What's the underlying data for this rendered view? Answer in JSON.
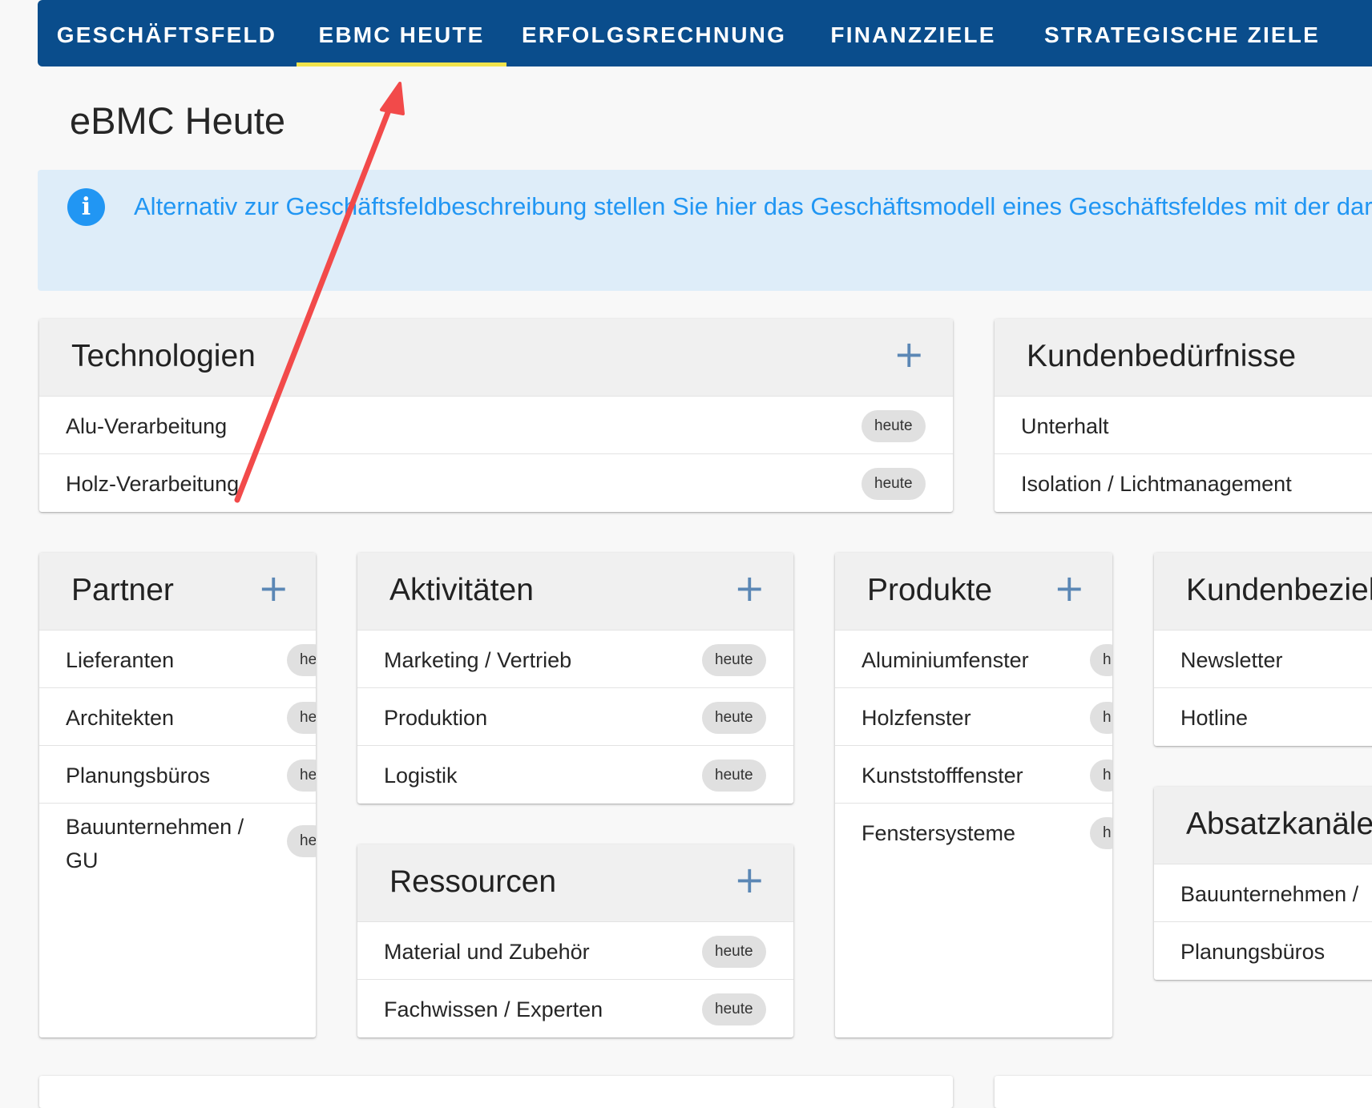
{
  "nav": {
    "tabs": [
      {
        "label": "GESCHÄFTSFELD"
      },
      {
        "label": "EBMC HEUTE"
      },
      {
        "label": "ERFOLGSRECHNUNG"
      },
      {
        "label": "FINANZZIELE"
      },
      {
        "label": "STRATEGISCHE ZIELE"
      }
    ],
    "active_tab": "EBMC HEUTE",
    "active_indicator_color": "#f1e34b"
  },
  "page": {
    "title": "eBMC Heute"
  },
  "info_box": {
    "icon": "info-icon",
    "text": "Alternativ zur Geschäftsfeldbeschreibung stellen Sie hier das Geschäftsmodell eines Geschäftsfeldes mit der dar."
  },
  "badge_label": "heute",
  "cards": {
    "technologien": {
      "title": "Technologien",
      "add_icon": "+",
      "items": [
        {
          "label": "Alu-Verarbeitung",
          "badge": "heute"
        },
        {
          "label": "Holz-Verarbeitung",
          "badge": "heute"
        }
      ]
    },
    "kundenbeduerfnisse": {
      "title": "Kundenbedürfnisse",
      "items": [
        {
          "label": "Unterhalt"
        },
        {
          "label": "Isolation / Lichtmanagement"
        }
      ]
    },
    "partner": {
      "title": "Partner",
      "add_icon": "+",
      "items": [
        {
          "label": "Lieferanten",
          "badge": "he"
        },
        {
          "label": "Architekten",
          "badge": "he"
        },
        {
          "label": "Planungsbüros",
          "badge": "he"
        },
        {
          "label": "Bauunternehmen / GU",
          "badge": "he"
        }
      ]
    },
    "aktivitaeten": {
      "title": "Aktivitäten",
      "add_icon": "+",
      "items": [
        {
          "label": "Marketing / Vertrieb",
          "badge": "heute"
        },
        {
          "label": "Produktion",
          "badge": "heute"
        },
        {
          "label": "Logistik",
          "badge": "heute"
        }
      ]
    },
    "ressourcen": {
      "title": "Ressourcen",
      "add_icon": "+",
      "items": [
        {
          "label": "Material und Zubehör",
          "badge": "heute"
        },
        {
          "label": "Fachwissen / Experten",
          "badge": "heute"
        }
      ]
    },
    "produkte": {
      "title": "Produkte",
      "add_icon": "+",
      "items": [
        {
          "label": "Aluminiumfenster",
          "badge": "h"
        },
        {
          "label": "Holzfenster",
          "badge": "h"
        },
        {
          "label": "Kunststofffenster",
          "badge": "h"
        },
        {
          "label": "Fenstersysteme",
          "badge": "h"
        }
      ]
    },
    "kundenbeziehungen": {
      "title": "Kundenbeziel",
      "items": [
        {
          "label": "Newsletter"
        },
        {
          "label": "Hotline"
        }
      ]
    },
    "absatzkanaele": {
      "title": "Absatzkanäle",
      "items": [
        {
          "label": "Bauunternehmen /"
        },
        {
          "label": "Planungsbüros"
        }
      ]
    }
  },
  "annotation": {
    "type": "arrow",
    "color": "#f24a4a",
    "points_to": "EBMC HEUTE"
  }
}
